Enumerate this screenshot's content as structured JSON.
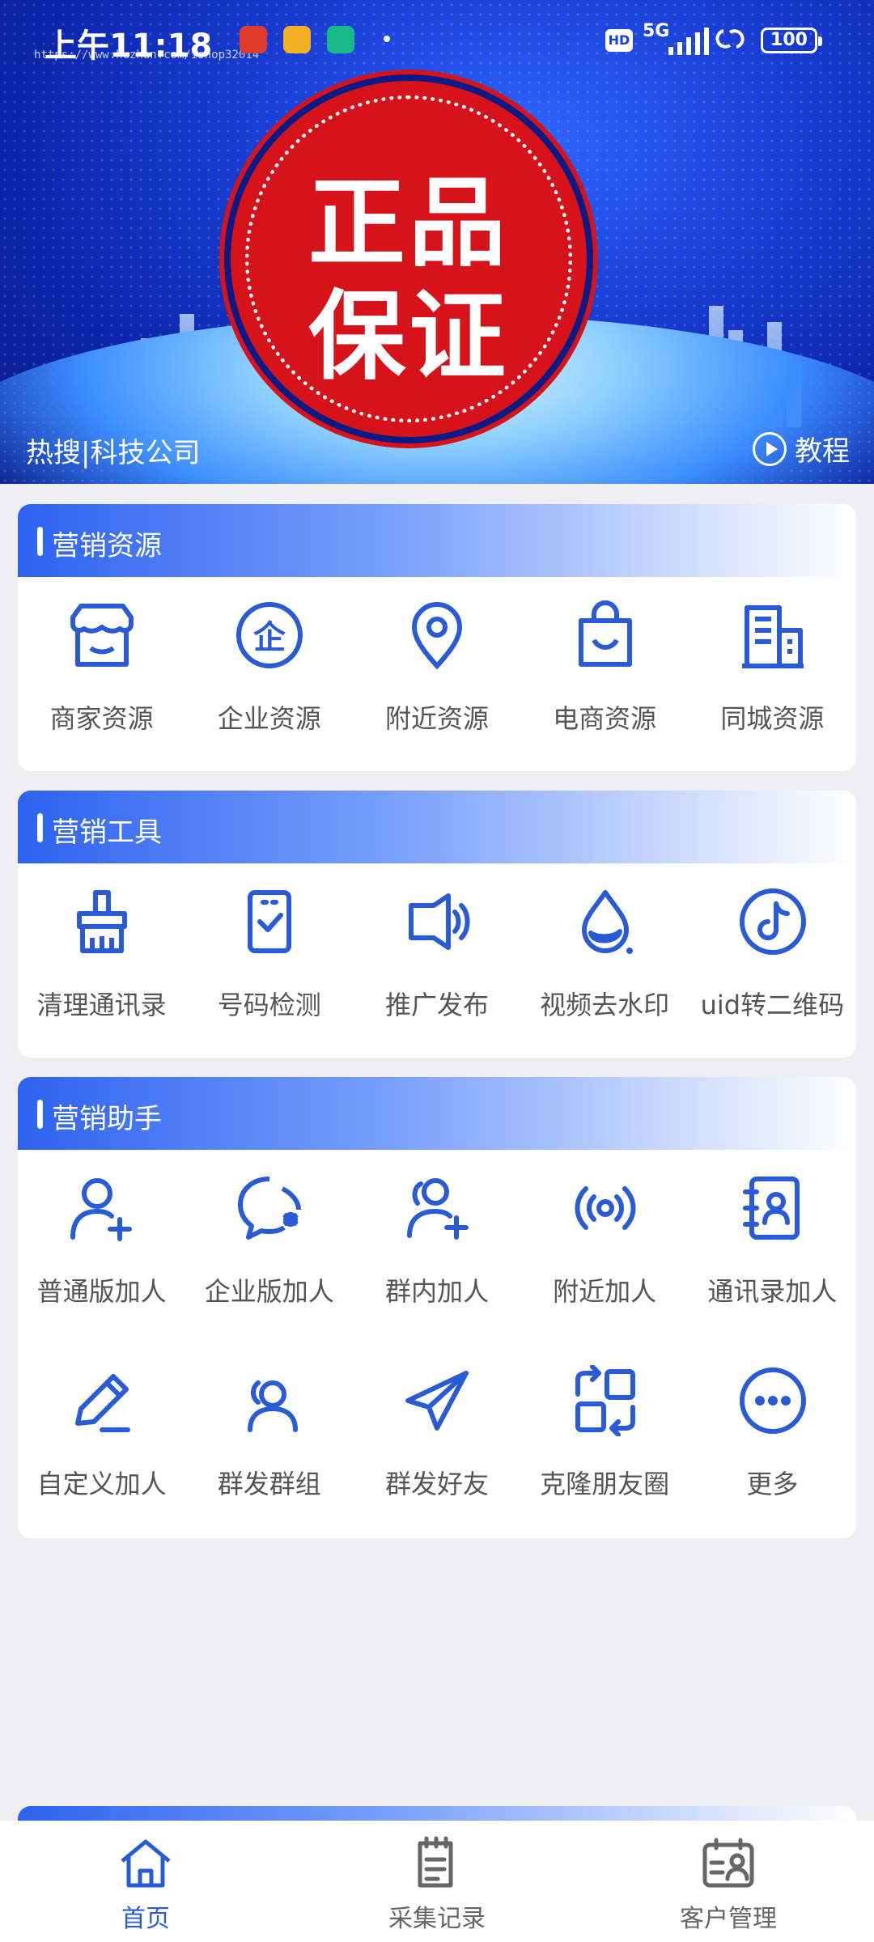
{
  "status_bar": {
    "time": "上午11:18",
    "watermark": "https://www.huzhan.com/ishop32014",
    "network": "5G",
    "hd": "HD",
    "battery": "100"
  },
  "banner": {
    "seal_line1": "正品",
    "seal_line2": "保证",
    "hot_search": "热搜|科技公司",
    "tutorial_label": "教程"
  },
  "sections": [
    {
      "title": "营销资源",
      "items": [
        {
          "label": "商家资源",
          "icon": "store-icon"
        },
        {
          "label": "企业资源",
          "icon": "enterprise-icon"
        },
        {
          "label": "附近资源",
          "icon": "location-pin-icon"
        },
        {
          "label": "电商资源",
          "icon": "shopping-bag-icon"
        },
        {
          "label": "同城资源",
          "icon": "building-icon"
        }
      ]
    },
    {
      "title": "营销工具",
      "items": [
        {
          "label": "清理通讯录",
          "icon": "brush-icon"
        },
        {
          "label": "号码检测",
          "icon": "phone-check-icon"
        },
        {
          "label": "推广发布",
          "icon": "speaker-icon"
        },
        {
          "label": "视频去水印",
          "icon": "water-drop-icon"
        },
        {
          "label": "uid转二维码",
          "icon": "tiktok-icon"
        }
      ]
    },
    {
      "title": "营销助手",
      "items": [
        {
          "label": "普通版加人",
          "icon": "user-add-icon"
        },
        {
          "label": "企业版加人",
          "icon": "chat-bubble-icon"
        },
        {
          "label": "群内加人",
          "icon": "group-add-icon"
        },
        {
          "label": "附近加人",
          "icon": "radar-icon"
        },
        {
          "label": "通讯录加人",
          "icon": "contacts-book-icon"
        },
        {
          "label": "自定义加人",
          "icon": "pencil-icon"
        },
        {
          "label": "群发群组",
          "icon": "group-send-icon"
        },
        {
          "label": "群发好友",
          "icon": "paper-plane-icon"
        },
        {
          "label": "克隆朋友圈",
          "icon": "clone-icon"
        },
        {
          "label": "更多",
          "icon": "more-icon"
        }
      ]
    }
  ],
  "bottom_nav": [
    {
      "label": "首页",
      "icon": "home-icon",
      "active": true
    },
    {
      "label": "采集记录",
      "icon": "clipboard-icon",
      "active": false
    },
    {
      "label": "客户管理",
      "icon": "customer-card-icon",
      "active": false
    }
  ],
  "colors": {
    "accent": "#2a5bd7",
    "seal_red": "#d6121b",
    "banner_blue": "#1a3fd6",
    "label_gray": "#555555"
  }
}
